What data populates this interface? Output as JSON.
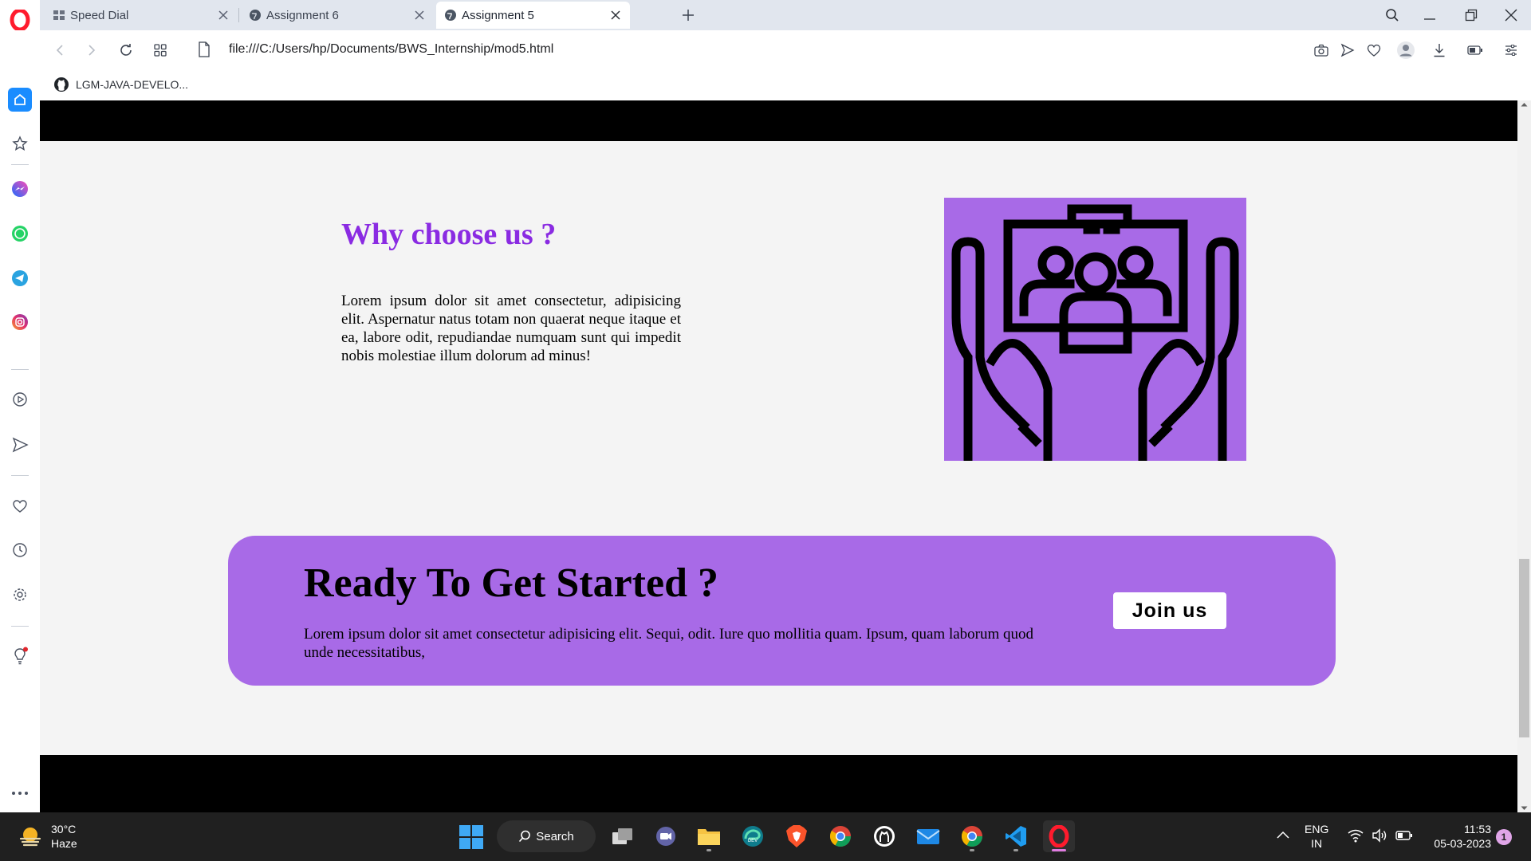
{
  "browser": {
    "tabs": [
      {
        "title": "Speed Dial",
        "icon": "speed-dial-icon",
        "active": false
      },
      {
        "title": "Assignment 6",
        "icon": "globe-icon",
        "active": false
      },
      {
        "title": "Assignment 5",
        "icon": "globe-icon",
        "active": true
      }
    ],
    "url": "file:///C:/Users/hp/Documents/BWS_Internship/mod5.html",
    "bookmarks": [
      {
        "label": "LGM-JAVA-DEVELO...",
        "icon": "github-icon"
      }
    ]
  },
  "page": {
    "why_title": "Why choose us ?",
    "why_text": "Lorem ipsum dolor sit amet consectetur, adipisicing elit. Aspernatur natus totam non quaerat neque itaque et ea, labore odit, repudiandae numquam sunt qui impedit nobis molestiae illum dolorum ad minus!",
    "illustration_icon": "hands-holding-team-icon",
    "cta": {
      "title": "Ready To Get Started ?",
      "text": "Lorem ipsum dolor sit amet consectetur adipisicing elit. Sequi, odit. Iure quo mollitia quam. Ipsum, quam laborum quod unde necessitatibus,",
      "button_label": "Join us"
    },
    "colors": {
      "accent_purple": "#8a2be2",
      "panel_purple": "#a86ae7",
      "band_black": "#000000",
      "page_bg": "#f4f4f4"
    }
  },
  "taskbar": {
    "weather_temp": "30°C",
    "weather_desc": "Haze",
    "search_label": "Search",
    "lang_top": "ENG",
    "lang_bottom": "IN",
    "time": "11:53",
    "date": "05-03-2023",
    "notification_count": "1"
  }
}
